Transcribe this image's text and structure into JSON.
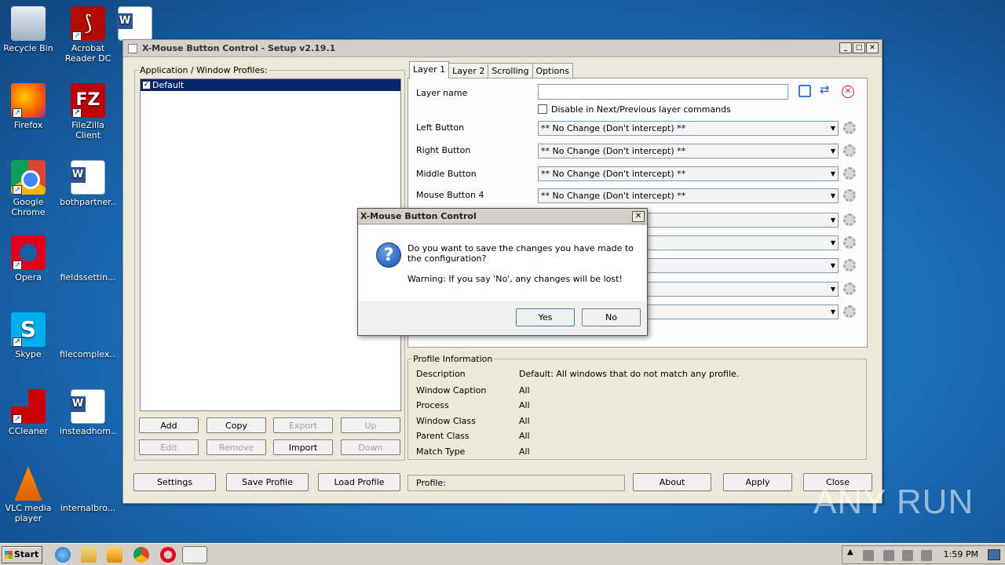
{
  "desktop": {
    "icons": [
      {
        "label": "Recycle Bin"
      },
      {
        "label": "Acrobat Reader DC"
      },
      {
        "label": "Firefox"
      },
      {
        "label": "FileZilla Client"
      },
      {
        "label": "Google Chrome"
      },
      {
        "label": "bothpartner..."
      },
      {
        "label": "Opera"
      },
      {
        "label": "fieldssettin..."
      },
      {
        "label": "Skype"
      },
      {
        "label": "filecomplex...."
      },
      {
        "label": "CCleaner"
      },
      {
        "label": "insteadhom..."
      },
      {
        "label": "VLC media player"
      },
      {
        "label": "internalbro..."
      }
    ]
  },
  "window": {
    "title": "X-Mouse Button Control - Setup v2.19.1",
    "controls": {
      "minimize": "_",
      "maximize": "□",
      "close": "✕"
    },
    "profiles": {
      "legend": "Application / Window Profiles:",
      "items": [
        {
          "label": "Default",
          "checked": true
        }
      ],
      "buttons": {
        "add": "Add",
        "copy": "Copy",
        "export": "Export",
        "up": "Up",
        "edit": "Edit",
        "remove": "Remove",
        "import": "Import",
        "down": "Down"
      }
    },
    "tabs": [
      "Layer 1",
      "Layer 2",
      "Scrolling",
      "Options"
    ],
    "layer": {
      "name_label": "Layer name",
      "name_value": "",
      "disable_checkbox": "Disable in Next/Previous layer commands",
      "rows": [
        {
          "label": "Left Button",
          "value": "** No Change (Don't intercept) **"
        },
        {
          "label": "Right Button",
          "value": "** No Change (Don't intercept) **"
        },
        {
          "label": "Middle Button",
          "value": "** No Change (Don't intercept) **"
        },
        {
          "label": "Mouse Button 4",
          "value": "** No Change (Don't intercept) **"
        },
        {
          "label": "",
          "value": "pt) **"
        },
        {
          "label": "",
          "value": "pt) **"
        },
        {
          "label": "",
          "value": "pt) **"
        },
        {
          "label": "",
          "value": "pt) **"
        },
        {
          "label": "",
          "value": "pt) **"
        }
      ]
    },
    "profile_info": {
      "legend": "Profile Information",
      "rows": [
        {
          "label": "Description",
          "value": "Default: All windows that do not match any profile."
        },
        {
          "label": "Window Caption",
          "value": "All"
        },
        {
          "label": "Process",
          "value": "All"
        },
        {
          "label": "Window Class",
          "value": "All"
        },
        {
          "label": "Parent Class",
          "value": "All"
        },
        {
          "label": "Match Type",
          "value": "All"
        }
      ]
    },
    "bottom": {
      "settings": "Settings",
      "save_profile": "Save Profile",
      "load_profile": "Load Profile",
      "profile_status": "Profile:",
      "about": "About",
      "apply": "Apply",
      "close": "Close"
    }
  },
  "dialog": {
    "title": "X-Mouse Button Control",
    "close": "✕",
    "icon": "question-icon",
    "message": "Do you want to save the changes you have made to the configuration?",
    "warning": "Warning: If you say 'No', any changes will be lost!",
    "yes": "Yes",
    "no": "No"
  },
  "taskbar": {
    "start": "Start",
    "apps": [
      "ie-icon",
      "explorer-icon",
      "media-icon",
      "chrome-icon",
      "opera-icon",
      "xmouse-icon"
    ],
    "clock": "1:59 PM"
  },
  "watermark": "ANY RUN"
}
